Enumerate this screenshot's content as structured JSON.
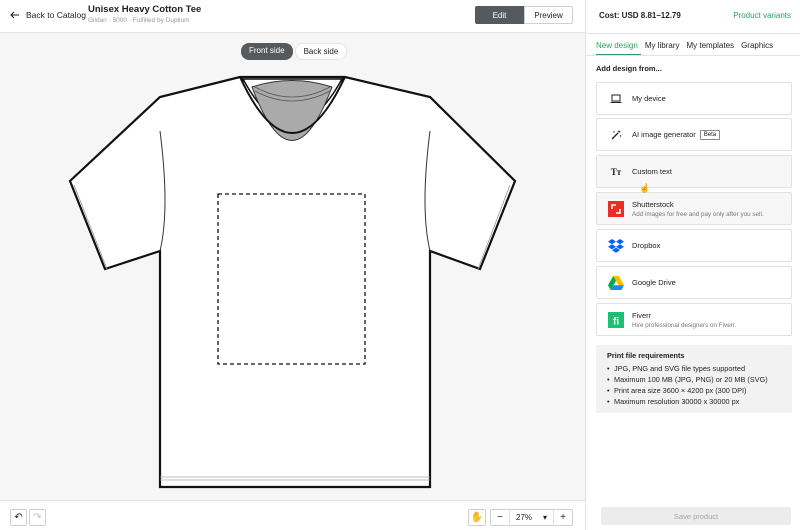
{
  "header": {
    "back_label": "Back to Catalog",
    "title": "Unisex Heavy Cotton Tee",
    "subtitle": "Gildan · 5000 · Fulfilled by Duplium",
    "edit_label": "Edit",
    "preview_label": "Preview"
  },
  "canvas": {
    "front_label": "Front side",
    "back_label": "Back side"
  },
  "footer": {
    "zoom_value": "27%",
    "minus": "−",
    "plus": "+"
  },
  "panel": {
    "cost": "Cost: USD 8.81–12.79",
    "variants_link": "Product variants",
    "tabs": [
      "New design",
      "My library",
      "My templates",
      "Graphics"
    ],
    "add_label": "Add design from...",
    "sources": [
      {
        "label": "My device",
        "sub": ""
      },
      {
        "label": "AI image generator",
        "sub": "",
        "badge": "Beta"
      },
      {
        "label": "Custom text",
        "sub": ""
      },
      {
        "label": "Shutterstock",
        "sub": "Add images for free and pay only after you sell."
      },
      {
        "label": "Dropbox",
        "sub": ""
      },
      {
        "label": "Google Drive",
        "sub": ""
      },
      {
        "label": "Fiverr",
        "sub": "Hire professional designers on Fiverr."
      }
    ],
    "requirements": {
      "title": "Print file requirements",
      "items": [
        "JPG, PNG and SVG file types supported",
        "Maximum 100 MB (JPG, PNG) or 20 MB (SVG)",
        "Print area size 3600 × 4200 px (300 DPI)",
        "Maximum resolution 30000 x 30000 px"
      ]
    },
    "save_label": "Save product"
  },
  "colors": {
    "accent": "#2f9e5d",
    "dark_button": "#555a5f",
    "shutterstock": "#ee2b24",
    "fiverr": "#1dbf73"
  }
}
